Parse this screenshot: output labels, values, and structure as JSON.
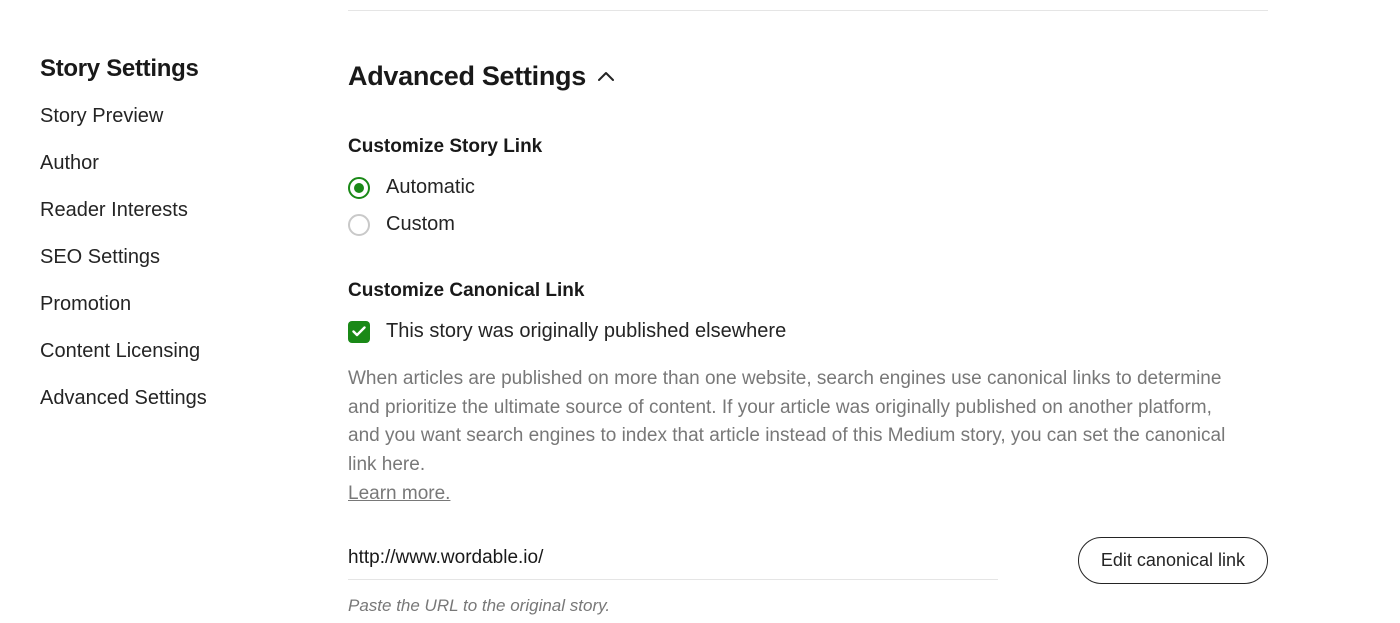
{
  "sidebar": {
    "title": "Story Settings",
    "items": [
      "Story Preview",
      "Author",
      "Reader Interests",
      "SEO Settings",
      "Promotion",
      "Content Licensing",
      "Advanced Settings"
    ]
  },
  "section": {
    "title": "Advanced Settings",
    "customize_link_label": "Customize Story Link",
    "radio_automatic": "Automatic",
    "radio_custom": "Custom",
    "canonical_label": "Customize Canonical Link",
    "checkbox_label": "This story was originally published elsewhere",
    "help_text": "When articles are published on more than one website, search engines use canonical links to determine and prioritize the ultimate source of content. If your article was originally published on another platform, and you want search engines to index that article instead of this Medium story, you can set the canonical link here.",
    "learn_more": "Learn more.",
    "url_value": "http://www.wordable.io/",
    "url_hint": "Paste the URL to the original story.",
    "edit_button": "Edit canonical link"
  }
}
